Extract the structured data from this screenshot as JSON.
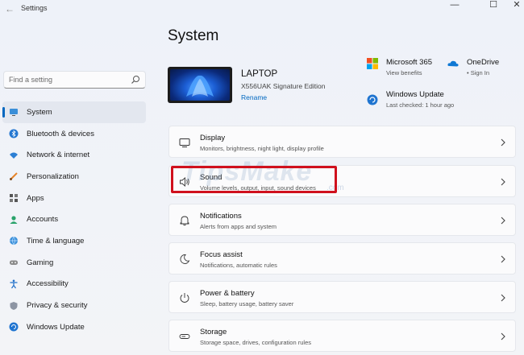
{
  "window": {
    "title": "Settings",
    "minimize": "—",
    "maximize": "☐",
    "close": "✕"
  },
  "search": {
    "placeholder": "Find a setting"
  },
  "sidebar": {
    "items": [
      {
        "label": "System",
        "icon": "system-icon"
      },
      {
        "label": "Bluetooth & devices",
        "icon": "bluetooth-icon"
      },
      {
        "label": "Network & internet",
        "icon": "wifi-icon"
      },
      {
        "label": "Personalization",
        "icon": "brush-icon"
      },
      {
        "label": "Apps",
        "icon": "apps-icon"
      },
      {
        "label": "Accounts",
        "icon": "account-icon"
      },
      {
        "label": "Time & language",
        "icon": "globe-icon"
      },
      {
        "label": "Gaming",
        "icon": "gamepad-icon"
      },
      {
        "label": "Accessibility",
        "icon": "accessibility-icon"
      },
      {
        "label": "Privacy & security",
        "icon": "shield-icon"
      },
      {
        "label": "Windows Update",
        "icon": "update-icon"
      }
    ]
  },
  "main": {
    "title": "System",
    "device": {
      "name": "LAPTOP",
      "model": "X556UAK Signature Edition",
      "rename": "Rename"
    },
    "tiles": [
      {
        "title": "Microsoft 365",
        "sub": "View benefits",
        "icon": "microsoft365-icon"
      },
      {
        "title": "OneDrive",
        "sub": "• Sign In",
        "icon": "onedrive-icon"
      },
      {
        "title": "Windows Update",
        "sub": "Last checked: 1 hour ago",
        "icon": "windows-update-icon"
      }
    ],
    "cards": [
      {
        "title": "Display",
        "sub": "Monitors, brightness, night light, display profile",
        "icon": "display-icon"
      },
      {
        "title": "Sound",
        "sub": "Volume levels, output, input, sound devices",
        "icon": "speaker-icon"
      },
      {
        "title": "Notifications",
        "sub": "Alerts from apps and system",
        "icon": "bell-icon"
      },
      {
        "title": "Focus assist",
        "sub": "Notifications, automatic rules",
        "icon": "moon-icon"
      },
      {
        "title": "Power & battery",
        "sub": "Sleep, battery usage, battery saver",
        "icon": "power-icon"
      },
      {
        "title": "Storage",
        "sub": "Storage space, drives, configuration rules",
        "icon": "storage-icon"
      }
    ]
  },
  "watermark": {
    "text": "TipsMake",
    "small": ".com"
  },
  "colors": {
    "accent": "#0067c0",
    "highlight": "#d0101d"
  }
}
